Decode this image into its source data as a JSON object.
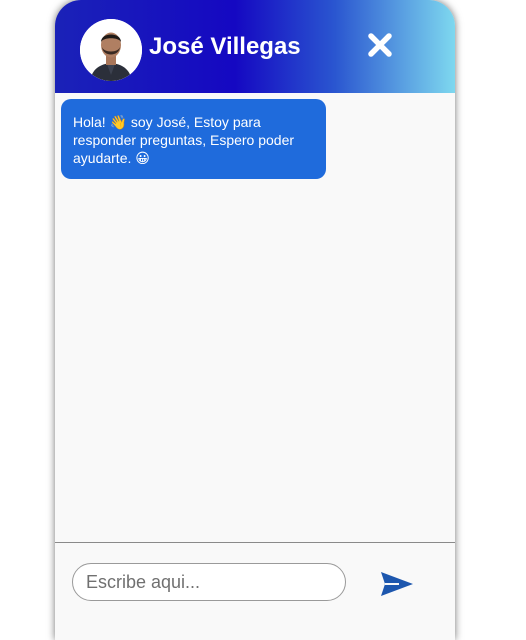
{
  "header": {
    "contact_name": "José Villegas",
    "close_icon": "close-icon",
    "avatar_icon": "avatar"
  },
  "messages": [
    {
      "text": "Hola! 👋 soy José, Estoy para responder preguntas, Espero poder ayudarte. 😀"
    }
  ],
  "composer": {
    "placeholder": "Escribe aqui...",
    "value": "",
    "send_icon": "send-icon"
  },
  "colors": {
    "header_gradient_start": "#1a22b8",
    "header_gradient_end": "#7ed8ef",
    "bubble": "#1f6bdc",
    "send_icon": "#1d57ae"
  }
}
